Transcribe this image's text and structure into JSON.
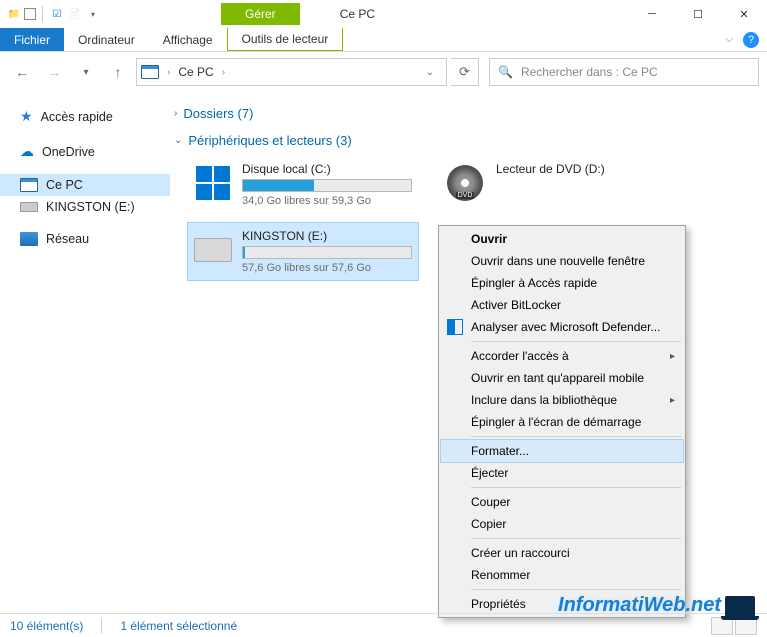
{
  "titlebar": {
    "manage_tab": "Gérer",
    "title": "Ce PC"
  },
  "ribbon": {
    "file": "Fichier",
    "computer": "Ordinateur",
    "view": "Affichage",
    "drive_tools": "Outils de lecteur"
  },
  "address": {
    "location": "Ce PC",
    "search_placeholder": "Rechercher dans : Ce PC"
  },
  "nav": {
    "quick_access": "Accès rapide",
    "onedrive": "OneDrive",
    "this_pc": "Ce PC",
    "kingston": "KINGSTON (E:)",
    "network": "Réseau"
  },
  "groups": {
    "folders": "Dossiers (7)",
    "devices": "Périphériques et lecteurs (3)"
  },
  "drives": {
    "c": {
      "name": "Disque local (C:)",
      "sub": "34,0 Go libres sur 59,3 Go",
      "fill": "42%"
    },
    "dvd": {
      "name": "Lecteur de DVD (D:)"
    },
    "e": {
      "name": "KINGSTON (E:)",
      "sub": "57,6 Go libres sur 57,6 Go",
      "fill": "1%"
    }
  },
  "context_menu": {
    "open": "Ouvrir",
    "open_new_window": "Ouvrir dans une nouvelle fenêtre",
    "pin_quick": "Épingler à Accès rapide",
    "bitlocker": "Activer BitLocker",
    "defender": "Analyser avec Microsoft Defender...",
    "grant_access": "Accorder l'accès à",
    "open_mobile": "Ouvrir en tant qu'appareil mobile",
    "include_library": "Inclure dans la bibliothèque",
    "pin_start": "Épingler à l'écran de démarrage",
    "format": "Formater...",
    "eject": "Éjecter",
    "cut": "Couper",
    "copy": "Copier",
    "shortcut": "Créer un raccourci",
    "rename": "Renommer",
    "properties": "Propriétés"
  },
  "status": {
    "count": "10 élément(s)",
    "selected": "1 élément sélectionné"
  },
  "watermark": "InformatiWeb.net"
}
